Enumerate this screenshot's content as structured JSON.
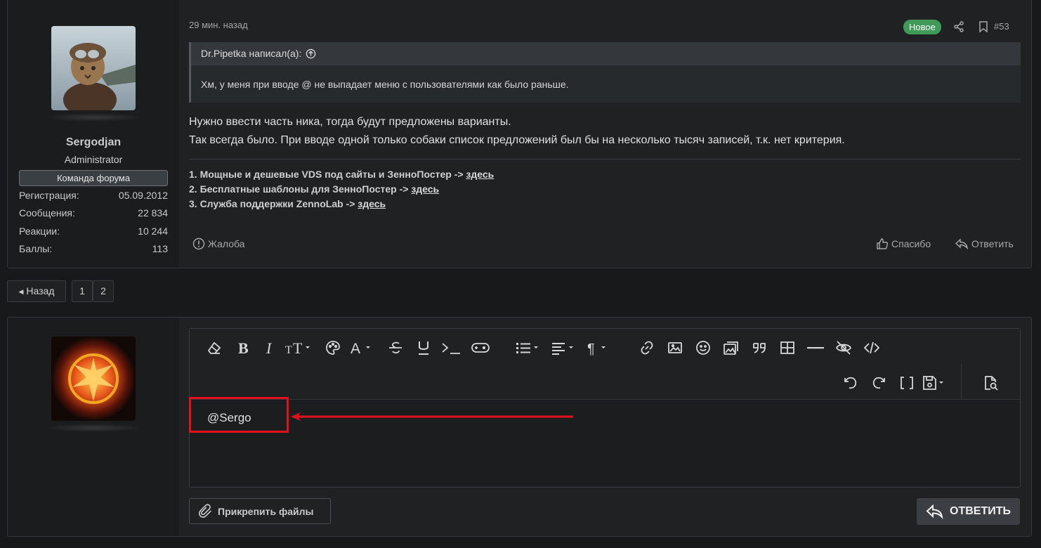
{
  "post": {
    "time": "29 мин. назад",
    "badge": "Новое",
    "number": "#53",
    "author": {
      "name": "Sergodjan",
      "title": "Administrator",
      "banner": "Команда форума",
      "stats": [
        {
          "label": "Регистрация:",
          "value": "05.09.2012"
        },
        {
          "label": "Сообщения:",
          "value": "22 834"
        },
        {
          "label": "Реакции:",
          "value": "10 244"
        },
        {
          "label": "Баллы:",
          "value": "113"
        }
      ]
    },
    "quote": {
      "header": "Dr.Pipetka написал(а):",
      "body": "Хм, у меня при вводе @ не выпадает меню с пользователями как было раньше."
    },
    "message_lines": [
      "Нужно ввести часть ника, тогда будут предложены варианты.",
      "Так всегда было. При вводе одной только собаки список предложений был бы на несколько тысяч записей, т.к. нет критерия."
    ],
    "signature": [
      {
        "text": "1. Мощные и дешевые VDS под сайты и ЗенноПостер -> ",
        "link": "здесь"
      },
      {
        "text": "2. Бесплатные шаблоны для ЗенноПостер -> ",
        "link": "здесь"
      },
      {
        "text": "3. Служба поддержки ZennoLab -> ",
        "link": "здесь"
      }
    ],
    "actions": {
      "report": "Жалоба",
      "like": "Спасибо",
      "reply": "Ответить"
    }
  },
  "pagination": {
    "back": "Назад",
    "pages": [
      "1",
      "2"
    ]
  },
  "reply_form": {
    "editor_text": "@Sergo",
    "attach_label": "Прикрепить файлы",
    "submit_label": "ОТВЕТИТЬ"
  },
  "colors": {
    "badge": "#3f9957",
    "annotation": "#e2121c",
    "background": "#17191b"
  }
}
